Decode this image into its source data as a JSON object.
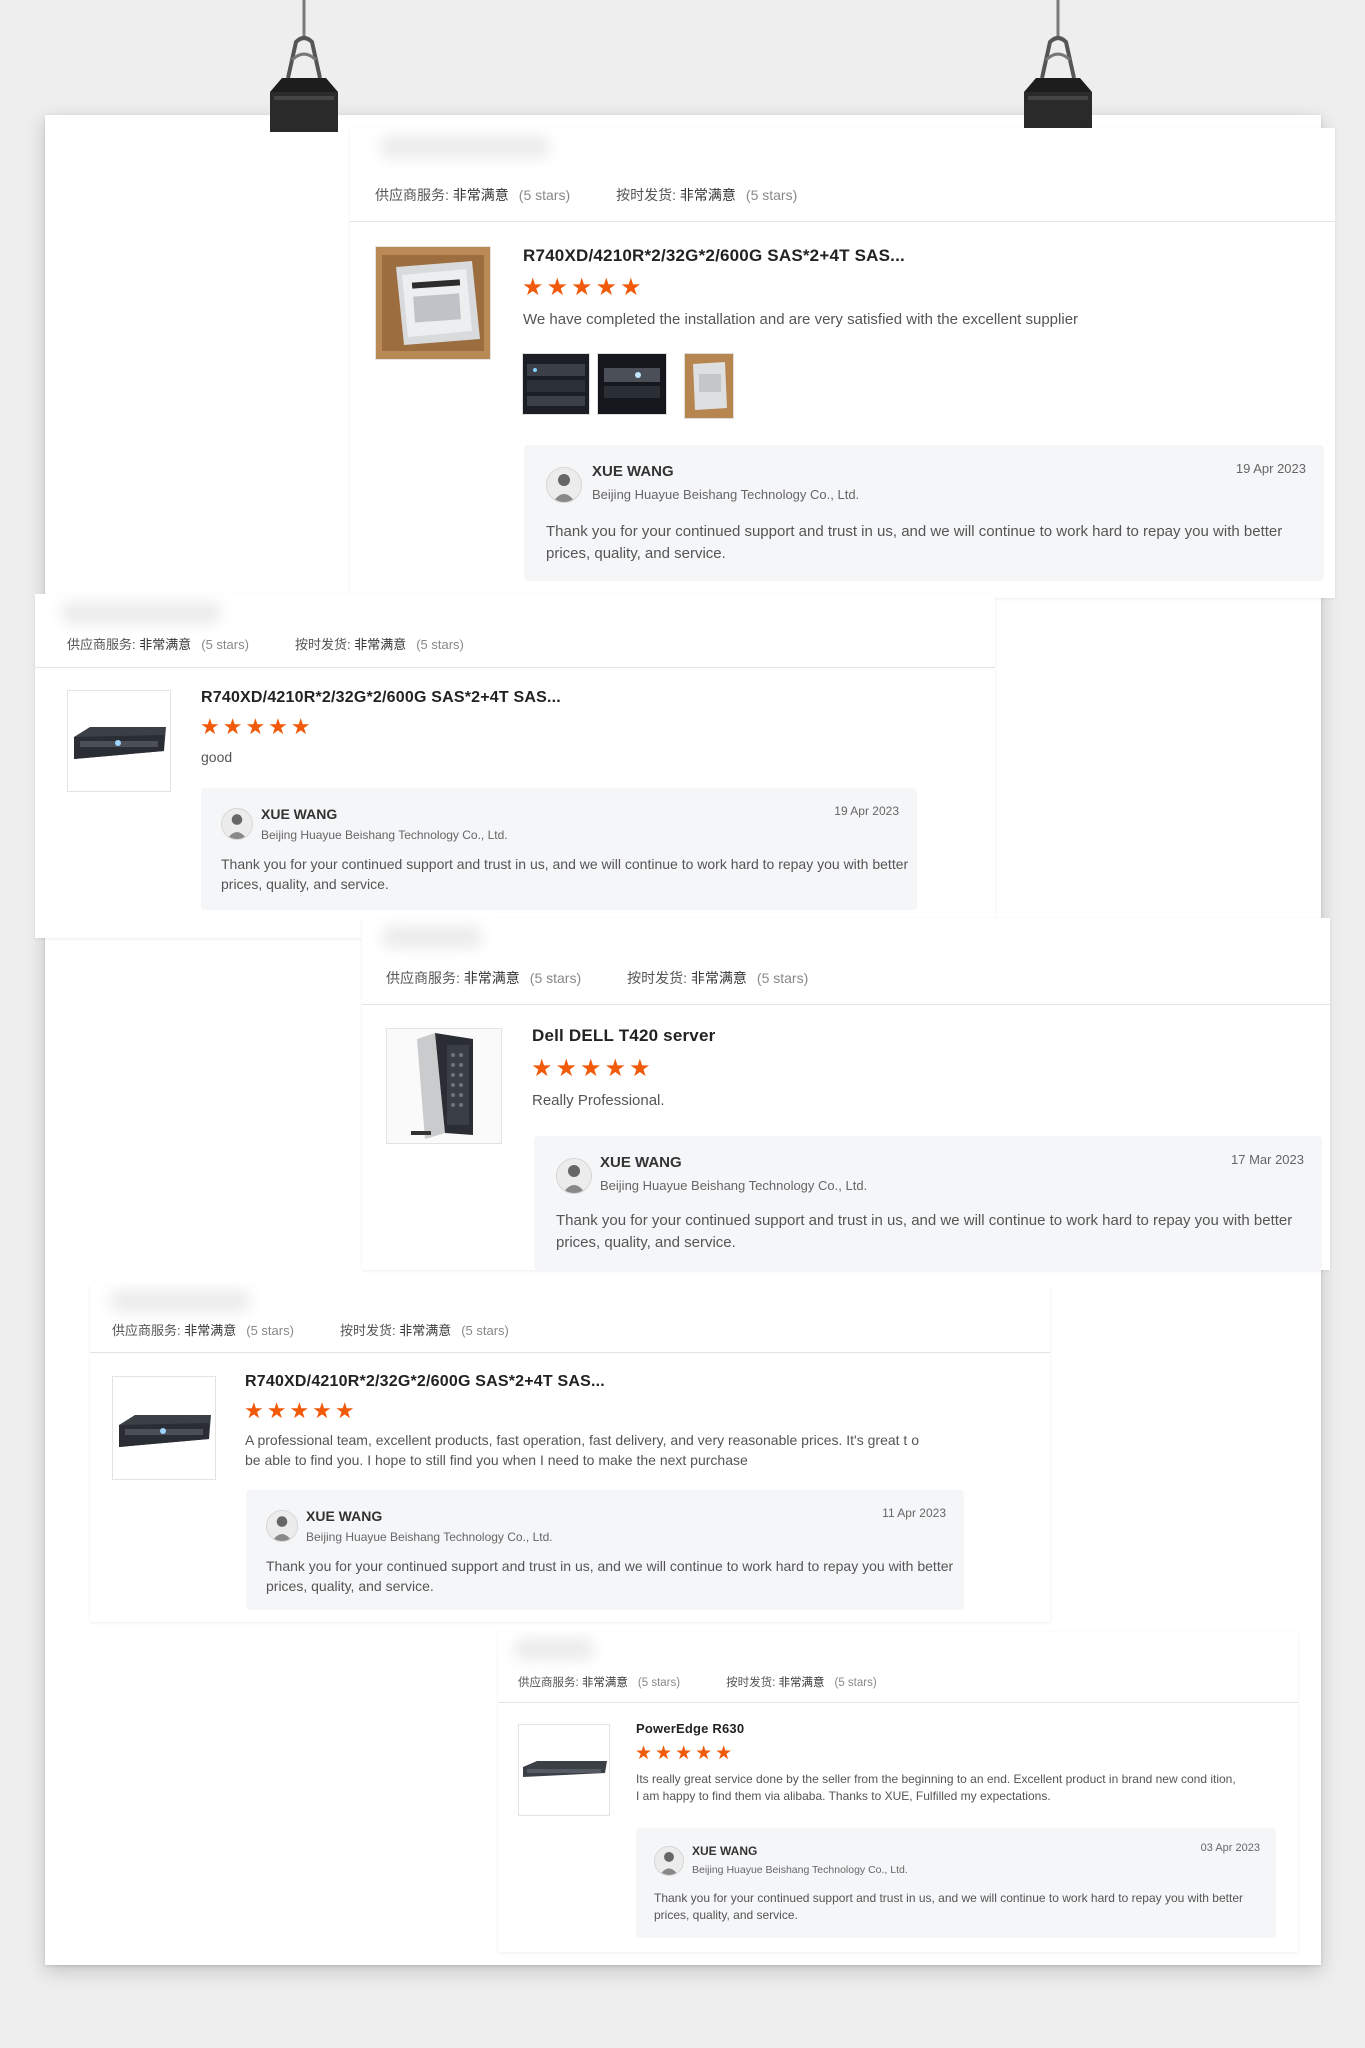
{
  "ratings": {
    "service_label": "供应商服务:",
    "service_value": "非常满意",
    "shipping_label": "按时发货:",
    "shipping_value": "非常满意",
    "stars_text": "(5 stars)"
  },
  "star_glyphs": "★★★★★",
  "reviews": [
    {
      "product_title": "R740XD/4210R*2/32G*2/600G SAS*2+4T SAS...",
      "rating": 5,
      "review_text": "We have completed the installation and are very satisfied with the excellent supplier",
      "reply": {
        "name": "XUE WANG",
        "company": "Beijing Huayue Beishang Technology Co., Ltd.",
        "date": "19 Apr 2023",
        "text": "Thank you for your continued support and trust in us, and we will continue to work hard to repay you with better prices, quality, and service."
      }
    },
    {
      "product_title": "R740XD/4210R*2/32G*2/600G SAS*2+4T SAS...",
      "rating": 5,
      "review_text": "good",
      "reply": {
        "name": "XUE WANG",
        "company": "Beijing Huayue Beishang Technology Co., Ltd.",
        "date": "19 Apr 2023",
        "text": "Thank you for your continued support and trust in us, and we will continue to work hard to repay you with better prices, quality, and service."
      }
    },
    {
      "product_title": "Dell DELL T420 server",
      "rating": 5,
      "review_text": "Really Professional.",
      "reply": {
        "name": "XUE WANG",
        "company": "Beijing Huayue Beishang Technology Co., Ltd.",
        "date": "17 Mar 2023",
        "text": "Thank you for your continued support and trust in us, and we will continue to work hard to repay you with better prices, quality, and service."
      }
    },
    {
      "product_title": "R740XD/4210R*2/32G*2/600G SAS*2+4T SAS...",
      "rating": 5,
      "review_text": "A professional team, excellent products, fast operation, fast delivery, and very reasonable prices. It's great t o be able to find you. I hope to still find you when I need to make the next purchase",
      "reply": {
        "name": "XUE WANG",
        "company": "Beijing Huayue Beishang Technology Co., Ltd.",
        "date": "11 Apr 2023",
        "text": "Thank you for your continued support and trust in us, and we will continue to work hard to repay you with better prices, quality, and service."
      }
    },
    {
      "product_title": "PowerEdge R630",
      "rating": 5,
      "review_text": "Its really great service done by the seller from the beginning to an end. Excellent product in brand new cond ition, I am happy to find them via alibaba. Thanks to XUE, Fulfilled my expectations.",
      "reply": {
        "name": "XUE WANG",
        "company": "Beijing Huayue Beishang Technology Co., Ltd.",
        "date": "03 Apr 2023",
        "text": "Thank you for your continued support and trust in us, and we will continue to work hard to repay you with better prices, quality, and service."
      }
    }
  ],
  "colors": {
    "star": "#f05a0a",
    "reply_background": "#f5f6f8",
    "page_background": "#eeeeef"
  }
}
